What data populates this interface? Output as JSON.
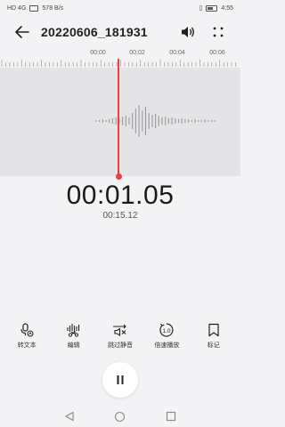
{
  "status_bar": {
    "left_text": "HD 4G",
    "speed": "578 B/s",
    "time": "4:55"
  },
  "header": {
    "title": "20220606_181931",
    "icons": [
      "back-arrow-icon",
      "volume-icon",
      "more-icon"
    ]
  },
  "timeline": {
    "labels": [
      "00:00",
      "00:02",
      "00:04",
      "00:06"
    ]
  },
  "player": {
    "current_time": "00:01.05",
    "total_time": "00:15.12",
    "state": "playing"
  },
  "toolbar": {
    "items": [
      {
        "label": "转文本",
        "icon": "speech-to-text-icon"
      },
      {
        "label": "编辑",
        "icon": "edit-wave-icon"
      },
      {
        "label": "跳过静音",
        "icon": "skip-silence-icon"
      },
      {
        "label": "倍速播放",
        "icon": "speed-1x-icon"
      },
      {
        "label": "标记",
        "icon": "bookmark-icon"
      }
    ]
  },
  "colors": {
    "accent": "#e8413c",
    "background": "#f3f3f5",
    "wave_bg": "#e4e4e6"
  }
}
